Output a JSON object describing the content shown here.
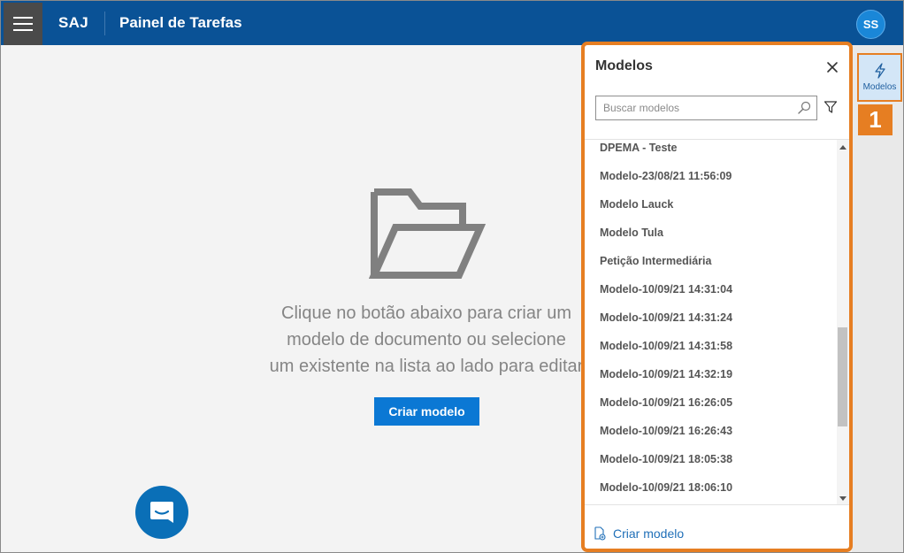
{
  "header": {
    "brand": "SAJ",
    "title": "Painel de Tarefas",
    "user_initials": "SS"
  },
  "main": {
    "empty_lines": [
      "Clique no botão abaixo para criar um",
      "modelo de documento ou selecione",
      "um existente na lista ao lado para editar"
    ],
    "create_label": "Criar modelo"
  },
  "rail": {
    "modelos_label": "Modelos",
    "callout": "1"
  },
  "panel": {
    "title": "Modelos",
    "search_placeholder": "Buscar modelos",
    "items": [
      "DPEMA - Teste",
      "Modelo-23/08/21 11:56:09",
      "Modelo Lauck",
      "Modelo Tula",
      "Petição Intermediária",
      "Modelo-10/09/21 14:31:04",
      "Modelo-10/09/21 14:31:24",
      "Modelo-10/09/21 14:31:58",
      "Modelo-10/09/21 14:32:19",
      "Modelo-10/09/21 16:26:05",
      "Modelo-10/09/21 16:26:43",
      "Modelo-10/09/21 18:05:38",
      "Modelo-10/09/21 18:06:10"
    ],
    "footer_label": "Criar modelo"
  },
  "colors": {
    "header_bg": "#0a5296",
    "accent": "#0b78d4",
    "highlight": "#e67e22"
  },
  "icons": [
    "hamburger-icon",
    "folder-icon",
    "chat-icon",
    "lightning-icon",
    "close-icon",
    "search-icon",
    "filter-icon",
    "document-add-icon"
  ]
}
